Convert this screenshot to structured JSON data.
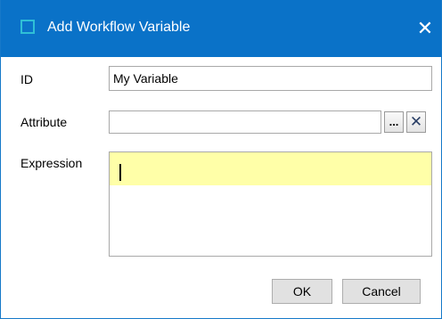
{
  "window": {
    "title": "Add Workflow Variable",
    "close_glyph": "✕"
  },
  "form": {
    "id_label": "ID",
    "id_value": "My Variable",
    "attribute_label": "Attribute",
    "attribute_value": "",
    "browse_label": "...",
    "clear_glyph": "✕",
    "expression_label": "Expression",
    "expression_value": ""
  },
  "buttons": {
    "ok": "OK",
    "cancel": "Cancel"
  },
  "colors": {
    "titlebar": "#0a72c8",
    "title_icon": "#2fbfd6",
    "expression_highlight": "#ffffa8"
  }
}
